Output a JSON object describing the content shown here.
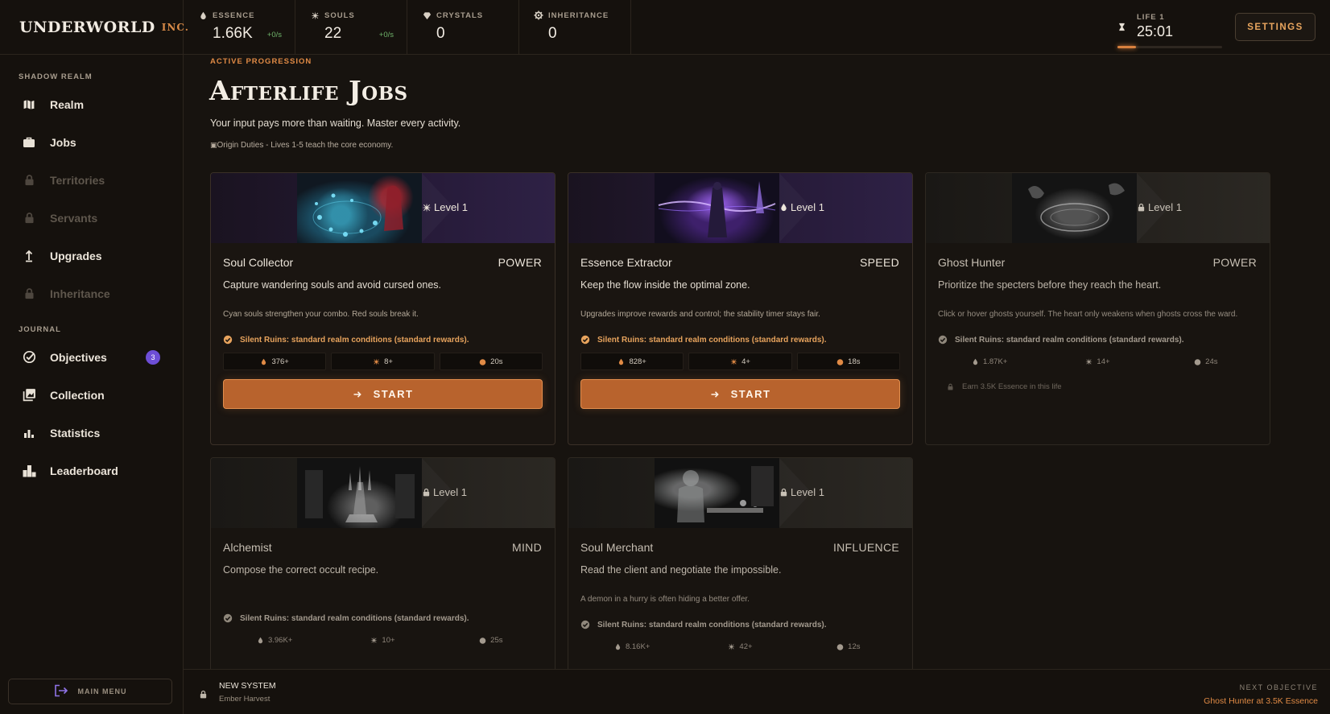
{
  "brand": {
    "name": "UNDERWORLD",
    "suffix": "INC."
  },
  "resources": [
    {
      "label": "ESSENCE",
      "icon": "drop-icon",
      "value": "1.66K",
      "rate": "+0/s"
    },
    {
      "label": "SOULS",
      "icon": "sparkle-icon",
      "value": "22",
      "rate": "+0/s"
    },
    {
      "label": "CRYSTALS",
      "icon": "gem-icon",
      "value": "0",
      "rate": ""
    },
    {
      "label": "INHERITANCE",
      "icon": "gear-icon",
      "value": "0",
      "rate": ""
    }
  ],
  "life": {
    "label": "LIFE 1",
    "time": "25:01",
    "progress": 0.18
  },
  "settings_label": "SETTINGS",
  "sidebar": {
    "section1": "SHADOW REALM",
    "section2": "JOURNAL",
    "realm": [
      {
        "label": "Realm",
        "icon": "map-icon",
        "locked": false
      },
      {
        "label": "Jobs",
        "icon": "briefcase-icon",
        "locked": false
      },
      {
        "label": "Territories",
        "icon": "lock-icon",
        "locked": true
      },
      {
        "label": "Servants",
        "icon": "lock-icon",
        "locked": true
      },
      {
        "label": "Upgrades",
        "icon": "arrow-up-icon",
        "locked": false
      },
      {
        "label": "Inheritance",
        "icon": "lock-icon",
        "locked": true
      }
    ],
    "journal": [
      {
        "label": "Objectives",
        "icon": "check-circle-icon",
        "badge": "3"
      },
      {
        "label": "Collection",
        "icon": "collection-icon",
        "badge": ""
      },
      {
        "label": "Statistics",
        "icon": "bar-chart-icon",
        "badge": ""
      },
      {
        "label": "Leaderboard",
        "icon": "podium-icon",
        "badge": ""
      }
    ],
    "main_menu": "MAIN MENU"
  },
  "header": {
    "eyebrow": "ACTIVE PROGRESSION",
    "title": "Afterlife Jobs",
    "subtitle": "Your input pays more than waiting. Master every activity.",
    "duties": "Origin Duties - Lives 1-5 teach the core economy."
  },
  "jobs": [
    {
      "name": "Soul Collector",
      "type": "POWER",
      "level": "Level 1",
      "level_icon": "sparkle-icon",
      "desc": "Capture wandering souls and avoid cursed ones.",
      "hint": "Cyan souls strengthen your combo. Red souls break it.",
      "condition": "Silent Ruins: standard realm conditions (standard rewards).",
      "stats": [
        "376+",
        "8+",
        "20s"
      ],
      "locked": false,
      "action": "START"
    },
    {
      "name": "Essence Extractor",
      "type": "SPEED",
      "level": "Level 1",
      "level_icon": "drop-icon",
      "desc": "Keep the flow inside the optimal zone.",
      "hint": "Upgrades improve rewards and control; the stability timer stays fair.",
      "condition": "Silent Ruins: standard realm conditions (standard rewards).",
      "stats": [
        "828+",
        "4+",
        "18s"
      ],
      "locked": false,
      "action": "START"
    },
    {
      "name": "Ghost Hunter",
      "type": "POWER",
      "level": "Level 1",
      "level_icon": "lock-icon",
      "desc": "Prioritize the specters before they reach the heart.",
      "hint": "Click or hover ghosts yourself. The heart only weakens when ghosts cross the ward.",
      "condition": "Silent Ruins: standard realm conditions (standard rewards).",
      "stats": [
        "1.87K+",
        "14+",
        "24s"
      ],
      "locked": true,
      "requirement": "Earn 3.5K Essence in this life"
    },
    {
      "name": "Alchemist",
      "type": "MIND",
      "level": "Level 1",
      "level_icon": "lock-icon",
      "desc": "Compose the correct occult recipe.",
      "hint": "",
      "condition": "Silent Ruins: standard realm conditions (standard rewards).",
      "stats": [
        "3.96K+",
        "10+",
        "25s"
      ],
      "locked": true
    },
    {
      "name": "Soul Merchant",
      "type": "INFLUENCE",
      "level": "Level 1",
      "level_icon": "lock-icon",
      "desc": "Read the client and negotiate the impossible.",
      "hint": "A demon in a hurry is often hiding a better offer.",
      "condition": "Silent Ruins: standard realm conditions (standard rewards).",
      "stats": [
        "8.16K+",
        "42+",
        "12s"
      ],
      "locked": true
    }
  ],
  "bottom": {
    "new_system_label": "NEW SYSTEM",
    "new_system_value": "Ember Harvest",
    "next_objective_label": "NEXT OBJECTIVE",
    "next_objective_value": "Ghost Hunter at 3.5K Essence"
  },
  "colors": {
    "accent": "#d9813e",
    "badge": "#6d4ed6",
    "rate": "#6fb36a"
  }
}
